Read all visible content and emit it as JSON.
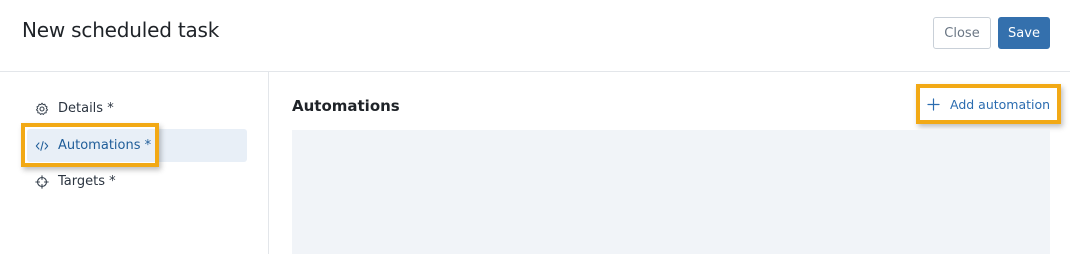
{
  "header": {
    "title": "New scheduled task",
    "close_label": "Close",
    "save_label": "Save",
    "save_color": "#3470ad"
  },
  "sidebar": {
    "items": [
      {
        "label": "Details *",
        "icon": "gear-icon",
        "active": false
      },
      {
        "label": "Automations *",
        "icon": "code-icon",
        "active": true
      },
      {
        "label": "Targets *",
        "icon": "crosshair-icon",
        "active": false
      }
    ]
  },
  "main": {
    "section_title": "Automations",
    "add_label": "Add automation",
    "add_icon": "plus-icon"
  },
  "colors": {
    "highlight": "#f2a915",
    "accent": "#2b6cb0",
    "panel_bg": "#f1f4f8"
  }
}
